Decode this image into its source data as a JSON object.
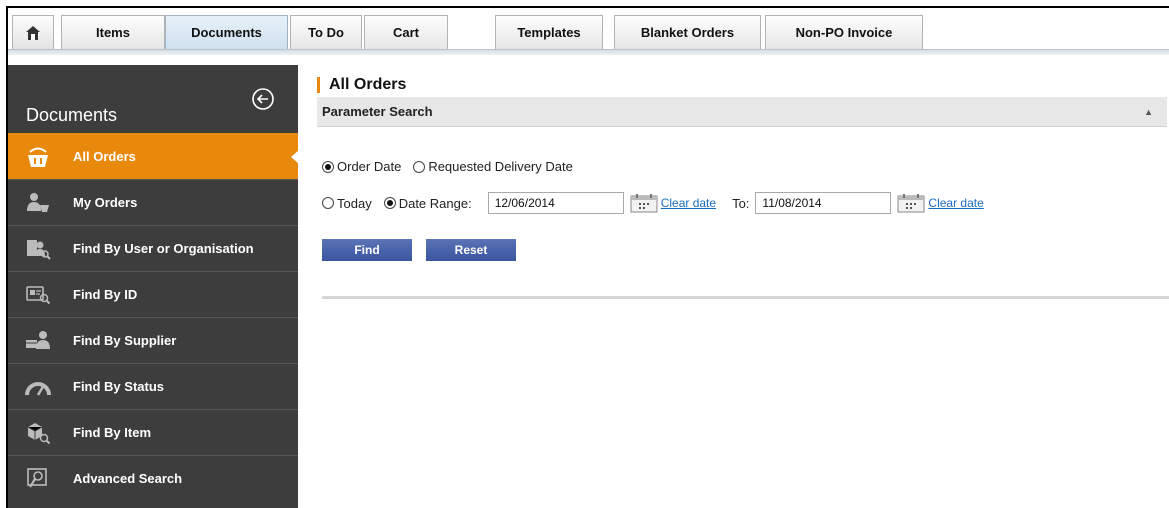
{
  "tabs": [
    {
      "label": "Items"
    },
    {
      "label": "Documents"
    },
    {
      "label": "To Do"
    },
    {
      "label": "Cart"
    },
    {
      "label": "Templates"
    },
    {
      "label": "Blanket Orders"
    },
    {
      "label": "Non-PO Invoice"
    }
  ],
  "active_tab": "Documents",
  "sidebar": {
    "title": "Documents",
    "items": [
      {
        "label": "All Orders",
        "icon": "basket-icon"
      },
      {
        "label": "My Orders",
        "icon": "user-cart-icon"
      },
      {
        "label": "Find By User or Organisation",
        "icon": "user-search-icon"
      },
      {
        "label": "Find By ID",
        "icon": "id-search-icon"
      },
      {
        "label": "Find By Supplier",
        "icon": "supplier-icon"
      },
      {
        "label": "Find By Status",
        "icon": "gauge-icon"
      },
      {
        "label": "Find By Item",
        "icon": "item-search-icon"
      },
      {
        "label": "Advanced Search",
        "icon": "advanced-search-icon"
      }
    ],
    "active_item": "All Orders"
  },
  "main": {
    "page_title": "All Orders",
    "panel_title": "Parameter Search",
    "date_type": {
      "options": [
        "Order Date",
        "Requested Delivery Date"
      ],
      "selected": "Order Date"
    },
    "date_scope": {
      "options": [
        "Today",
        "Date Range:"
      ],
      "selected": "Date Range:"
    },
    "from_date": "12/06/2014",
    "to_label": "To:",
    "to_date": "11/08/2014",
    "clear_date_label": "Clear date",
    "find_label": "Find",
    "reset_label": "Reset"
  },
  "colors": {
    "accent": "#e8890c",
    "sidebar_bg": "#3d3d3d",
    "button": "#4a64ab",
    "link": "#1a6bbf"
  }
}
